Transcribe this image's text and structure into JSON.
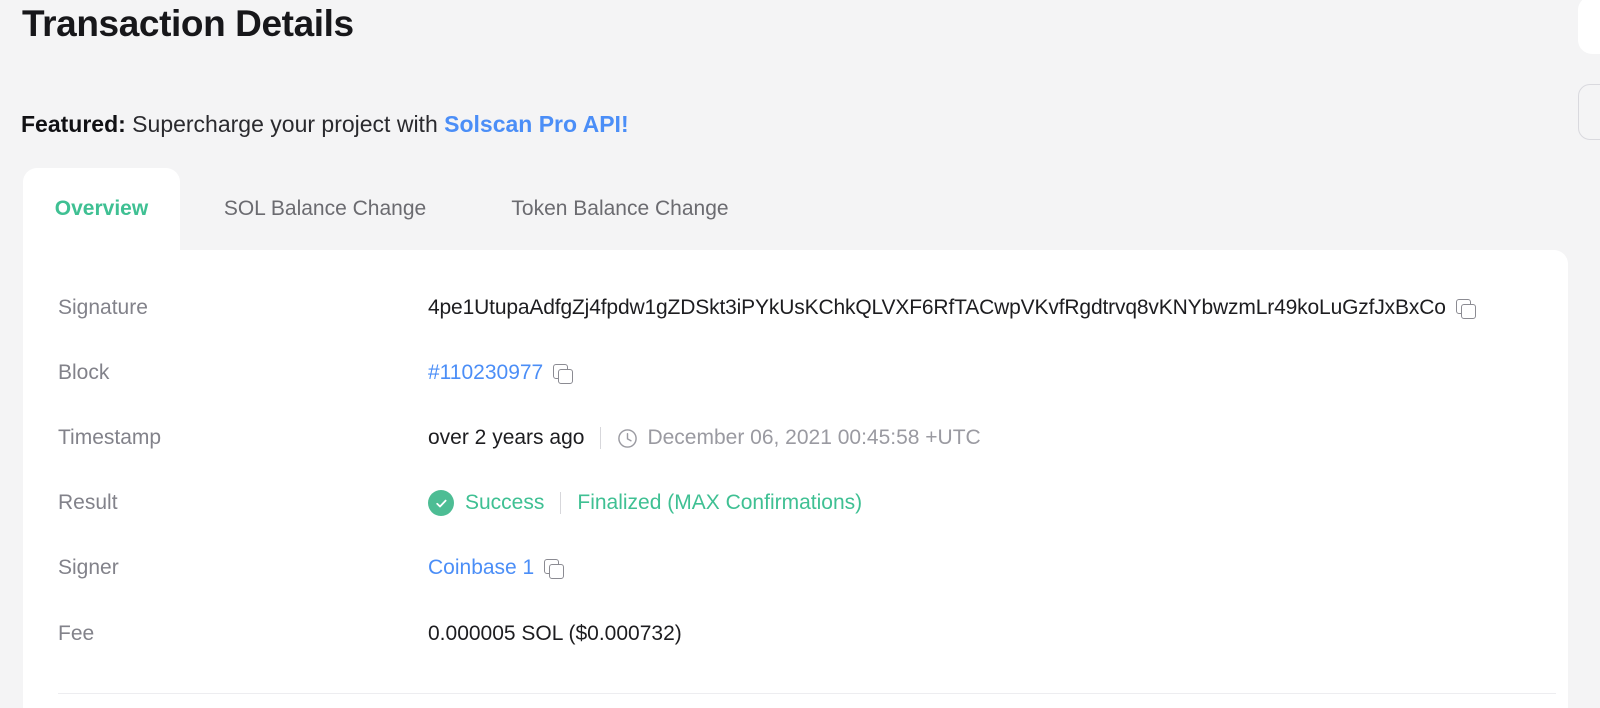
{
  "page": {
    "title": "Transaction Details",
    "background_color": "#f4f4f5"
  },
  "featured": {
    "label": "Featured:",
    "body": " Supercharge your project with ",
    "link": "Solscan Pro API!",
    "link_color": "#4b8ef7"
  },
  "tabs": {
    "active_index": 0,
    "active_color": "#3fc093",
    "items": [
      {
        "label": "Overview"
      },
      {
        "label": "SOL Balance Change"
      },
      {
        "label": "Token Balance Change"
      }
    ]
  },
  "overview": {
    "rows": [
      {
        "label": "Signature",
        "value": "4pe1UtupaAdfgZj4fpdw1gZDSkt3iPYkUsKChkQLVXF6RfTACwpVKvfRgdtrvq8vKNYbwzmLr49koLuGzfJxBxCo",
        "copy_icon": "copy-icon"
      },
      {
        "label": "Block",
        "value": "#110230977",
        "value_is_link": true,
        "copy_icon": "copy-icon"
      },
      {
        "label": "Timestamp",
        "value": "over 2 years ago",
        "clock_icon": "clock-icon",
        "value_secondary": "December 06, 2021 00:45:58 +UTC"
      },
      {
        "label": "Result",
        "status_icon": "check-circle-icon",
        "value": "Success",
        "value_secondary": "Finalized (MAX Confirmations)",
        "status_color": "#3fc093"
      },
      {
        "label": "Signer",
        "value": "Coinbase 1",
        "value_is_link": true,
        "copy_icon": "copy-icon"
      },
      {
        "label": "Fee",
        "value": "0.000005 SOL ($0.000732)"
      }
    ]
  }
}
